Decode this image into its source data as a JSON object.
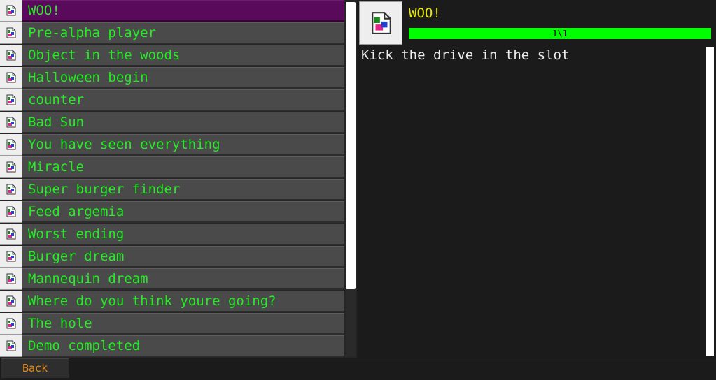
{
  "colors": {
    "item_text": "#22ee22",
    "selected_bg": "#5a0a5a",
    "title": "#e8e800",
    "progress_fill": "#00ff00",
    "back_text": "#e08a1a"
  },
  "achievements": {
    "icon_name": "broken-image-icon",
    "selected_index": 0,
    "items": [
      {
        "label": "WOO!"
      },
      {
        "label": "Pre-alpha player"
      },
      {
        "label": "Object in the woods"
      },
      {
        "label": "Halloween begin"
      },
      {
        "label": "counter"
      },
      {
        "label": "Bad Sun"
      },
      {
        "label": "You have seen everything"
      },
      {
        "label": "Miracle"
      },
      {
        "label": "Super burger finder"
      },
      {
        "label": "Feed argemia"
      },
      {
        "label": "Worst ending"
      },
      {
        "label": "Burger dream"
      },
      {
        "label": "Mannequin dream"
      },
      {
        "label": "Where do you think youre going?"
      },
      {
        "label": "The hole"
      },
      {
        "label": "Demo completed"
      }
    ]
  },
  "detail": {
    "title": "WOO!",
    "progress_text": "1\\1",
    "progress_fraction": 1.0,
    "description": "Kick the drive in the slot"
  },
  "footer": {
    "back_label": "Back"
  }
}
